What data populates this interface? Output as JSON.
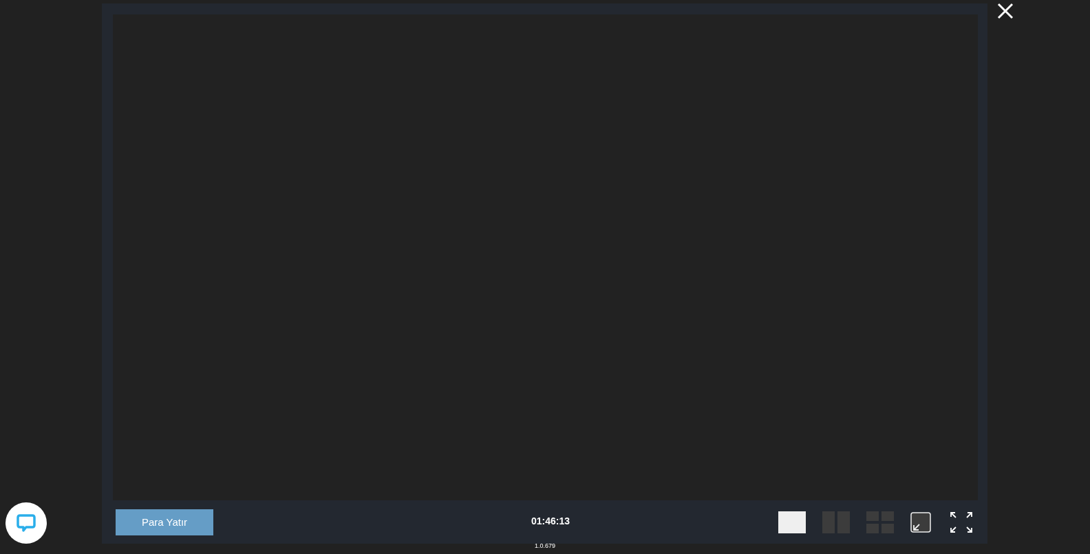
{
  "deposit_button": {
    "label": "Para Yatır"
  },
  "timer": "01:46:13",
  "layouts": [
    {
      "kind": "single",
      "selected": true
    },
    {
      "kind": "double",
      "selected": false
    },
    {
      "kind": "quad",
      "selected": false
    }
  ],
  "version": "1.0.679"
}
